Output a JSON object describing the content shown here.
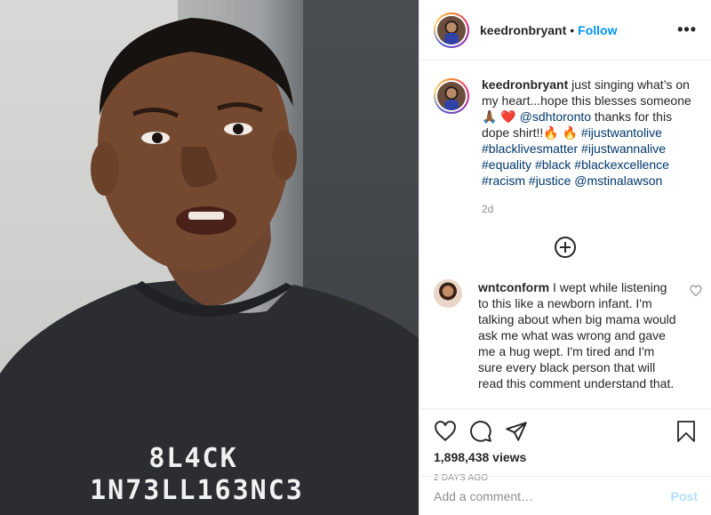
{
  "header": {
    "username": "keedronbryant",
    "separator": "•",
    "follow_label": "Follow",
    "more_label": "•••"
  },
  "media": {
    "shirt_line_1": "8L4CK",
    "shirt_line_2": "1N73LL163NC3"
  },
  "caption": {
    "username": "keedronbryant",
    "text_1": " just singing what’s on my heart...hope this blesses someone 🙏🏾 ❤️  ",
    "mention_1": "@sdhtoronto",
    "text_2": " thanks for this dope shirt!!🔥 🔥  ",
    "tags": [
      "#ijustwantolive",
      "#blacklivesmatter",
      "#ijustwannalive",
      "#equality",
      "#black",
      "#blackexcellence",
      "#racism",
      "#justice"
    ],
    "mention_2": "@mstinalawson",
    "time": "2d"
  },
  "comment": {
    "username": "wntconform",
    "text": " I wept while listening to this like a newborn infant. I'm talking about when big mama would ask me what was wrong and gave me a hug wept. I'm tired and I'm sure every black person that will read this comment understand that."
  },
  "stats": {
    "views": "1,898,438 views",
    "posted": "2 DAYS AGO"
  },
  "add_comment": {
    "placeholder": "Add a comment…",
    "post_label": "Post"
  }
}
